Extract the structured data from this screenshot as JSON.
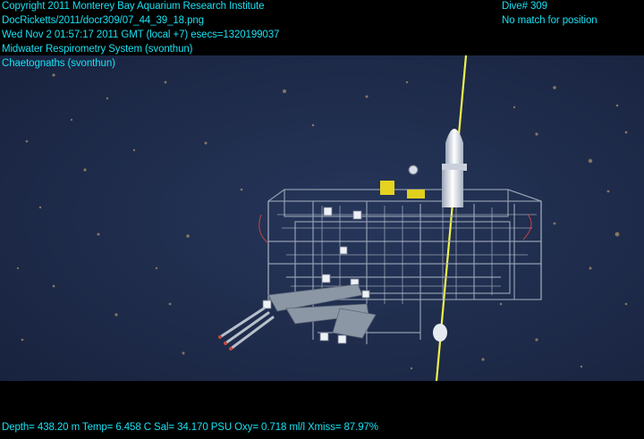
{
  "overlay": {
    "left_lines": [
      "Copyright 2011 Monterey Bay Aquarium Research Institute",
      "DocRicketts/2011/docr309/07_44_39_18.png",
      "Wed Nov  2 01:57:17 2011 GMT (local +7)  esecs=1320199037",
      "Midwater Respirometry System (svonthun)",
      "Chaetognaths (svonthun)"
    ],
    "right_lines": [
      "Dive# 309",
      "No match for position"
    ],
    "footer": "Depth= 438.20 m  Temp= 6.458 C  Sal= 34.170 PSU  Oxy= 0.718 ml/l  Xmiss= 87.97%"
  },
  "colors": {
    "overlay_text": "#19e0f2",
    "water": "#1d2a48",
    "tether": "#f1f04a"
  }
}
